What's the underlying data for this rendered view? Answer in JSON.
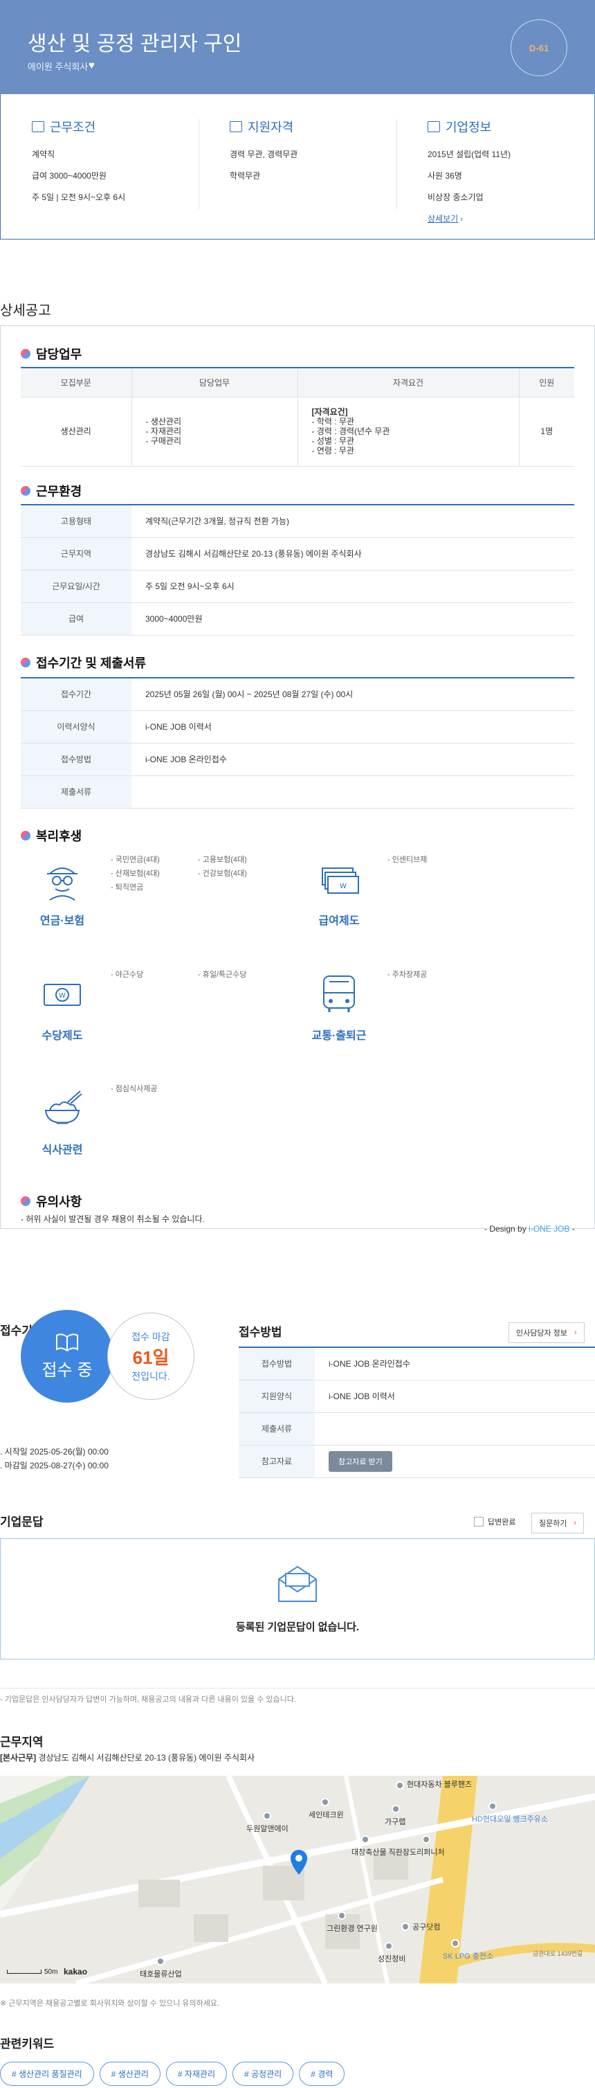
{
  "header": {
    "title": "생산 및 공정 관리자 구인",
    "company": "에이원 주식회사",
    "dday": "D-61"
  },
  "summary": {
    "work": {
      "title": "근무조건",
      "lines": [
        "계약직",
        "급여 3000~4000만원",
        "주 5일 | 오전 9시~오후 6시"
      ]
    },
    "qual": {
      "title": "지원자격",
      "lines": [
        "경력 무관, 경력무관",
        "학력무관"
      ]
    },
    "company": {
      "title": "기업정보",
      "lines": [
        "2015년 설립(업력 11년)",
        "사원 36명",
        "비상장 중소기업"
      ],
      "link": "상세보기"
    }
  },
  "detail": {
    "title": "상세공고",
    "duty": {
      "title": "담당업무",
      "headers": [
        "모집부문",
        "담당업무",
        "자격요건",
        "인원"
      ],
      "row": {
        "dept": "생산관리",
        "tasks": [
          "- 생산관리",
          "- 자재관리",
          "- 구매관리"
        ],
        "req_head": "[자격요건]",
        "reqs": [
          "- 학력 : 무관",
          "- 경력 : 경력(년수 무관",
          "- 성별 : 무관",
          "- 연령 : 무관"
        ],
        "count": "1명"
      }
    },
    "env": {
      "title": "근무환경",
      "rows": [
        {
          "k": "고용형태",
          "v": "계약직(근무기간 3개월, 정규직 전환 가능)"
        },
        {
          "k": "근무지역",
          "v": "경상남도 김해시 서김해산단로 20-13 (풍유동) 에이원 주식회사"
        },
        {
          "k": "근무요일/시간",
          "v": "주 5일 오전 9시~오후 6시"
        },
        {
          "k": "급여",
          "v": "3000~4000만원"
        }
      ]
    },
    "submit": {
      "title": "접수기간 및 제출서류",
      "rows": [
        {
          "k": "접수기간",
          "v": "2025년 05월 26일 (월) 00시 ~ 2025년 08월 27일 (수) 00시"
        },
        {
          "k": "이력서양식",
          "v": "i-ONE JOB 이력서"
        },
        {
          "k": "접수방법",
          "v": "i-ONE JOB 온라인접수"
        },
        {
          "k": "제출서류",
          "v": ""
        }
      ]
    },
    "welfare": {
      "title": "복리후생",
      "items": [
        {
          "label": "연금·보험",
          "icon": "insurance-person-icon",
          "col1": [
            "- 국민연금(4대)",
            "- 산재보험(4대)",
            "- 퇴직연금"
          ],
          "col2": [
            "- 고용보험(4대)",
            "- 건강보험(4대)"
          ]
        },
        {
          "label": "급여제도",
          "icon": "money-stack-icon",
          "col1": [
            "- 인센티브제"
          ],
          "col2": []
        },
        {
          "label": "수당제도",
          "icon": "cash-bill-icon",
          "col1": [
            "- 야근수당"
          ],
          "col2": [
            "- 휴일/특근수당"
          ]
        },
        {
          "label": "교통·출퇴근",
          "icon": "bus-icon",
          "col1": [
            "- 주차장제공"
          ],
          "col2": []
        },
        {
          "label": "식사관련",
          "icon": "rice-bowl-icon",
          "col1": [
            "- 점심식사제공"
          ],
          "col2": []
        }
      ]
    },
    "caution": {
      "title": "유의사항",
      "text": "- 허위 사실이 발견될 경우 채용이 취소될 수 있습니다.",
      "design_prefix": "- Design by ",
      "design_brand": "i-ONE JOB",
      "design_suffix": " -"
    }
  },
  "apply": {
    "period_title": "접수기간",
    "status": "접수 중",
    "deadline_label": "접수 마감",
    "deadline_days": "61일",
    "deadline_suffix": "전입니다.",
    "start": "시작일 2025-05-26(월) 00:00",
    "end": "마감일 2025-08-27(수) 00:00",
    "method_title": "접수방법",
    "hr_button": "인사담당자 정보",
    "rows": [
      {
        "k": "접수방법",
        "v": "i-ONE JOB 온라인접수"
      },
      {
        "k": "지원양식",
        "v": "i-ONE JOB 이력서"
      },
      {
        "k": "제출서류",
        "v": ""
      },
      {
        "k": "참고자료",
        "v": ""
      }
    ],
    "ref_button": "참고자료 받기"
  },
  "qa": {
    "title": "기업문답",
    "answered_label": "답변완료",
    "ask_button": "질문하기",
    "empty": "등록된 기업문답이 없습니다.",
    "note": "- 기업문답은 인사담당자가 답변이 가능하며, 채용공고의 내용과 다른 내용이 있을 수 있습니다."
  },
  "location": {
    "title": "근무지역",
    "tag": "[본사근무]",
    "address": "경상남도 김해시 서김해산단로 20-13 (풍유동) 에이원 주식회사",
    "map_labels": [
      "현대자동차 블루핸즈",
      "세인테크윈",
      "두원알앤에이",
      "가구랩",
      "HD현대오일 뱅크주유소",
      "대창축산물 직판장",
      "도리퍼니처",
      "그린환경 연구원",
      "공구닷컴",
      "성진정비",
      "SK LPG 충전소",
      "태호물류산업",
      "금관대로 1439번길"
    ],
    "scale": "50m",
    "map_brand": "kakao",
    "note": "※ 근무지역은 채용공고별로 회사위치와 상이할 수 있으니 유의하세요."
  },
  "keywords": {
    "title": "관련키워드",
    "items": [
      "# 생산관리 품질관리",
      "# 생산관리",
      "# 자재관리",
      "# 공정관리",
      "# 경력"
    ]
  },
  "colors": {
    "accent": "#2d6fbd",
    "hero": "#6b8fc4",
    "deadline": "#e85a1f"
  }
}
